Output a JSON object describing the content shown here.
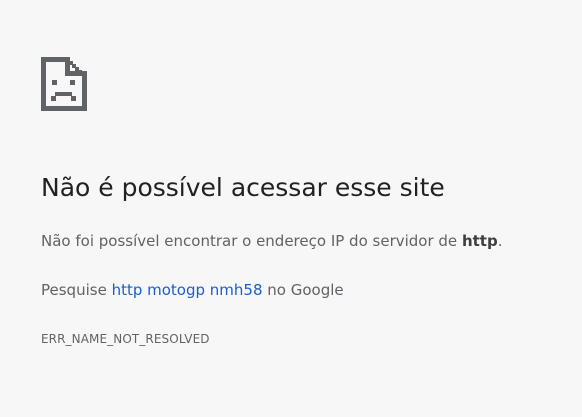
{
  "error_page": {
    "icon": "sad-document-icon",
    "title": "Não é possível acessar esse site",
    "description_prefix": "Não foi possível encontrar o endereço IP do servidor de ",
    "description_host": "http",
    "description_suffix": ".",
    "suggestion_prefix": "Pesquise ",
    "suggestion_link": "http motogp nmh58",
    "suggestion_suffix": " no Google",
    "error_code": "ERR_NAME_NOT_RESOLVED"
  },
  "colors": {
    "background": "#f7f7f7",
    "title": "#202124",
    "body_text": "#5f6368",
    "link": "#1a5fc8"
  }
}
